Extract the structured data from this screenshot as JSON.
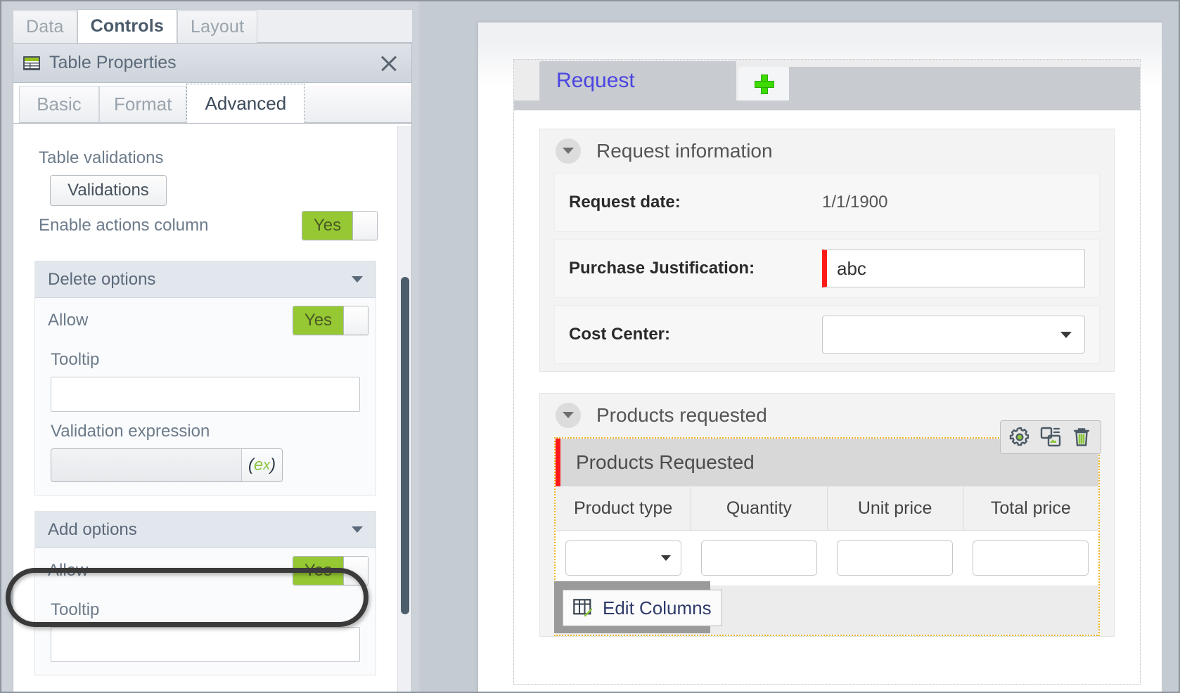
{
  "left": {
    "top_tabs": [
      {
        "label": "Data",
        "active": false
      },
      {
        "label": "Controls",
        "active": true
      },
      {
        "label": "Layout",
        "active": false
      }
    ],
    "window": {
      "title": "Table Properties",
      "icon": "table-icon",
      "close_icon": "close-icon"
    },
    "inner_tabs": [
      {
        "label": "Basic",
        "active": false
      },
      {
        "label": "Format",
        "active": false
      },
      {
        "label": "Advanced",
        "active": true
      }
    ],
    "table_validations_label": "Table validations",
    "validations_button": "Validations",
    "enable_actions_column": {
      "label": "Enable actions column",
      "value": "Yes"
    },
    "delete_options": {
      "title": "Delete options",
      "allow_label": "Allow",
      "allow_value": "Yes",
      "tooltip_label": "Tooltip",
      "tooltip_value": "",
      "validation_expression_label": "Validation expression",
      "validation_expression_value": "",
      "expression_button": "(ex)"
    },
    "add_options": {
      "title": "Add options",
      "allow_label": "Allow",
      "allow_value": "Yes",
      "tooltip_label": "Tooltip",
      "tooltip_value": ""
    },
    "accent_green": "#95c832",
    "highlight_color": "#3a3a3a"
  },
  "right": {
    "tabs": [
      {
        "label": "Request",
        "active": true
      }
    ],
    "add_tab_icon": "plus-icon",
    "sections": [
      {
        "title": "Request information",
        "chevron": "chevron-down-icon",
        "fields": [
          {
            "label": "Request date:",
            "type": "text",
            "value": "1/1/1900"
          },
          {
            "label": "Purchase Justification:",
            "type": "input",
            "value": "abc"
          },
          {
            "label": "Cost Center:",
            "type": "select",
            "value": ""
          }
        ]
      },
      {
        "title": "Products requested",
        "chevron": "chevron-down-icon"
      }
    ],
    "table": {
      "caption": "Products Requested",
      "columns": [
        "Product type",
        "Quantity",
        "Unit price",
        "Total price"
      ],
      "row": [
        {
          "type": "select",
          "value": ""
        },
        {
          "type": "input",
          "value": ""
        },
        {
          "type": "input",
          "value": ""
        },
        {
          "type": "input",
          "value": ""
        }
      ],
      "tools": [
        {
          "name": "gear-icon"
        },
        {
          "name": "duplicate-icon"
        },
        {
          "name": "trash-icon"
        }
      ],
      "edit_columns_button": "Edit Columns",
      "edit_columns_icon": "edit-columns-icon",
      "selection_border_color": "#f0b425",
      "required_marker_color": "#ff1a1a"
    }
  }
}
